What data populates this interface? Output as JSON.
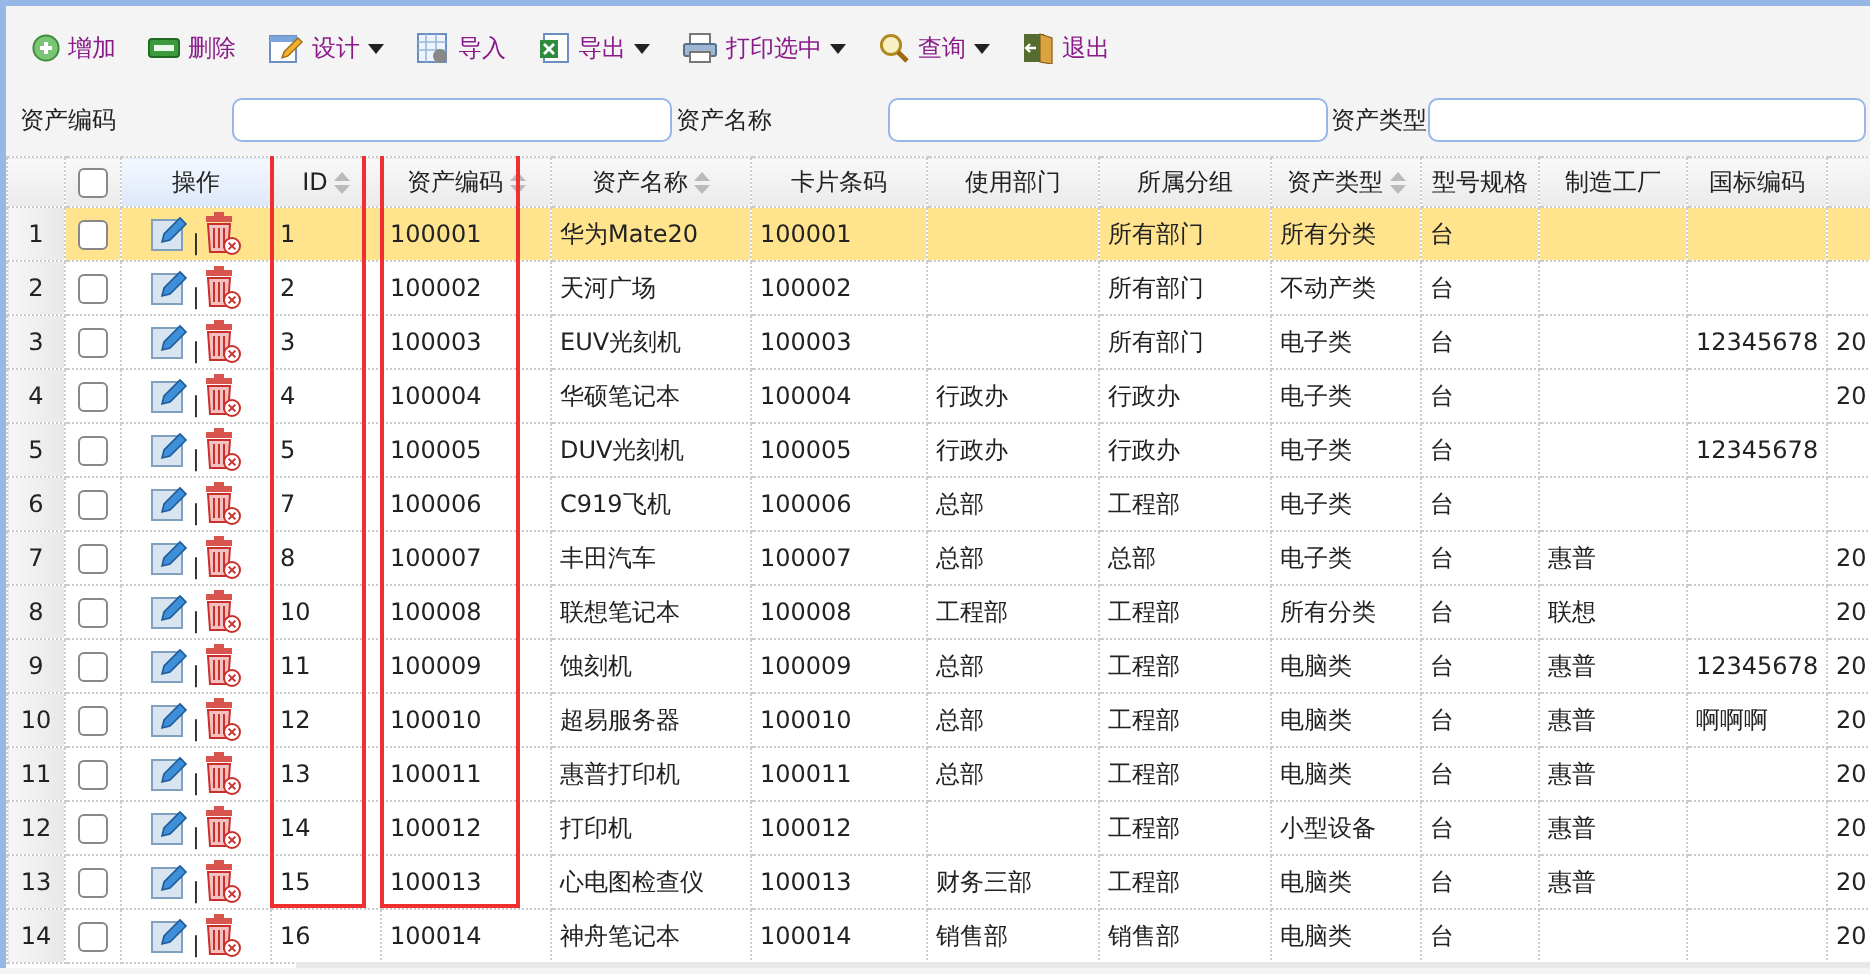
{
  "toolbar": [
    {
      "kind": "add",
      "label": "增加",
      "has_menu": false
    },
    {
      "kind": "delete",
      "label": "删除",
      "has_menu": false
    },
    {
      "kind": "design",
      "label": "设计",
      "has_menu": true
    },
    {
      "kind": "import",
      "label": "导入",
      "has_menu": false
    },
    {
      "kind": "export",
      "label": "导出",
      "has_menu": true
    },
    {
      "kind": "print",
      "label": "打印选中",
      "has_menu": true
    },
    {
      "kind": "query",
      "label": "查询",
      "has_menu": true
    },
    {
      "kind": "exit",
      "label": "退出",
      "has_menu": false
    }
  ],
  "search": [
    {
      "label": "资产编码"
    },
    {
      "label": "资产名称"
    },
    {
      "label": "资产类型"
    }
  ],
  "table": {
    "header_checkbox": {
      "checked": false
    },
    "actions_header": "操作",
    "columns": [
      {
        "label": "ID",
        "sortable": true,
        "highlighted": true
      },
      {
        "label": "资产编码",
        "sortable": true,
        "highlighted": true
      },
      {
        "label": "资产名称",
        "sortable": true,
        "highlighted": false
      },
      {
        "label": "卡片条码",
        "sortable": false,
        "highlighted": false
      },
      {
        "label": "使用部门",
        "sortable": false,
        "highlighted": false
      },
      {
        "label": "所属分组",
        "sortable": false,
        "highlighted": false
      },
      {
        "label": "资产类型",
        "sortable": true,
        "highlighted": false
      },
      {
        "label": "型号规格",
        "sortable": false,
        "highlighted": false
      },
      {
        "label": "制造工厂",
        "sortable": false,
        "highlighted": false
      },
      {
        "label": "国标编码",
        "sortable": false,
        "highlighted": false
      }
    ],
    "rows": [
      {
        "number": "1",
        "selected": true,
        "checked": false,
        "separator": "|",
        "cells": [
          "1",
          "100001",
          "华为Mate20",
          "100001",
          null,
          "所有部门",
          "所有分类",
          "台",
          null,
          null,
          null
        ]
      },
      {
        "number": "2",
        "selected": false,
        "checked": false,
        "separator": "|",
        "cells": [
          "2",
          "100002",
          "天河广场",
          "100002",
          null,
          "所有部门",
          "不动产类",
          "台",
          null,
          null,
          null
        ]
      },
      {
        "number": "3",
        "selected": false,
        "checked": false,
        "separator": "|",
        "cells": [
          "3",
          "100003",
          "EUV光刻机",
          "100003",
          null,
          "所有部门",
          "电子类",
          "台",
          null,
          "12345678",
          "20"
        ]
      },
      {
        "number": "4",
        "selected": false,
        "checked": false,
        "separator": "|",
        "cells": [
          "4",
          "100004",
          "华硕笔记本",
          "100004",
          "行政办",
          "行政办",
          "电子类",
          "台",
          null,
          null,
          "20"
        ]
      },
      {
        "number": "5",
        "selected": false,
        "checked": false,
        "separator": "|",
        "cells": [
          "5",
          "100005",
          "DUV光刻机",
          "100005",
          "行政办",
          "行政办",
          "电子类",
          "台",
          null,
          "12345678",
          null
        ]
      },
      {
        "number": "6",
        "selected": false,
        "checked": false,
        "separator": "|",
        "cells": [
          "7",
          "100006",
          "C919飞机",
          "100006",
          "总部",
          "工程部",
          "电子类",
          "台",
          null,
          null,
          null
        ]
      },
      {
        "number": "7",
        "selected": false,
        "checked": false,
        "separator": "|",
        "cells": [
          "8",
          "100007",
          "丰田汽车",
          "100007",
          "总部",
          "总部",
          "电子类",
          "台",
          "惠普",
          null,
          "20"
        ]
      },
      {
        "number": "8",
        "selected": false,
        "checked": false,
        "separator": "|",
        "cells": [
          "10",
          "100008",
          "联想笔记本",
          "100008",
          "工程部",
          "工程部",
          "所有分类",
          "台",
          "联想",
          null,
          "20"
        ]
      },
      {
        "number": "9",
        "selected": false,
        "checked": false,
        "separator": "|",
        "cells": [
          "11",
          "100009",
          "蚀刻机",
          "100009",
          "总部",
          "工程部",
          "电脑类",
          "台",
          "惠普",
          "12345678",
          "20"
        ]
      },
      {
        "number": "10",
        "selected": false,
        "checked": false,
        "separator": "|",
        "cells": [
          "12",
          "100010",
          "超易服务器",
          "100010",
          "总部",
          "工程部",
          "电脑类",
          "台",
          "惠普",
          "啊啊啊",
          "20"
        ]
      },
      {
        "number": "11",
        "selected": false,
        "checked": false,
        "separator": "|",
        "cells": [
          "13",
          "100011",
          "惠普打印机",
          "100011",
          "总部",
          "工程部",
          "电脑类",
          "台",
          "惠普",
          null,
          "20"
        ]
      },
      {
        "number": "12",
        "selected": false,
        "checked": false,
        "separator": "|",
        "cells": [
          "14",
          "100012",
          "打印机",
          "100012",
          null,
          "工程部",
          "小型设备",
          "台",
          "惠普",
          null,
          "20"
        ]
      },
      {
        "number": "13",
        "selected": false,
        "checked": false,
        "separator": "|",
        "cells": [
          "15",
          "100013",
          "心电图检查仪",
          "100013",
          "财务三部",
          "工程部",
          "电脑类",
          "台",
          "惠普",
          null,
          "20"
        ]
      },
      {
        "number": "14",
        "selected": false,
        "checked": false,
        "separator": "|",
        "cells": [
          "16",
          "100014",
          "神舟笔记本",
          "100014",
          "销售部",
          "销售部",
          "电脑类",
          "台",
          null,
          null,
          "20"
        ]
      }
    ]
  }
}
